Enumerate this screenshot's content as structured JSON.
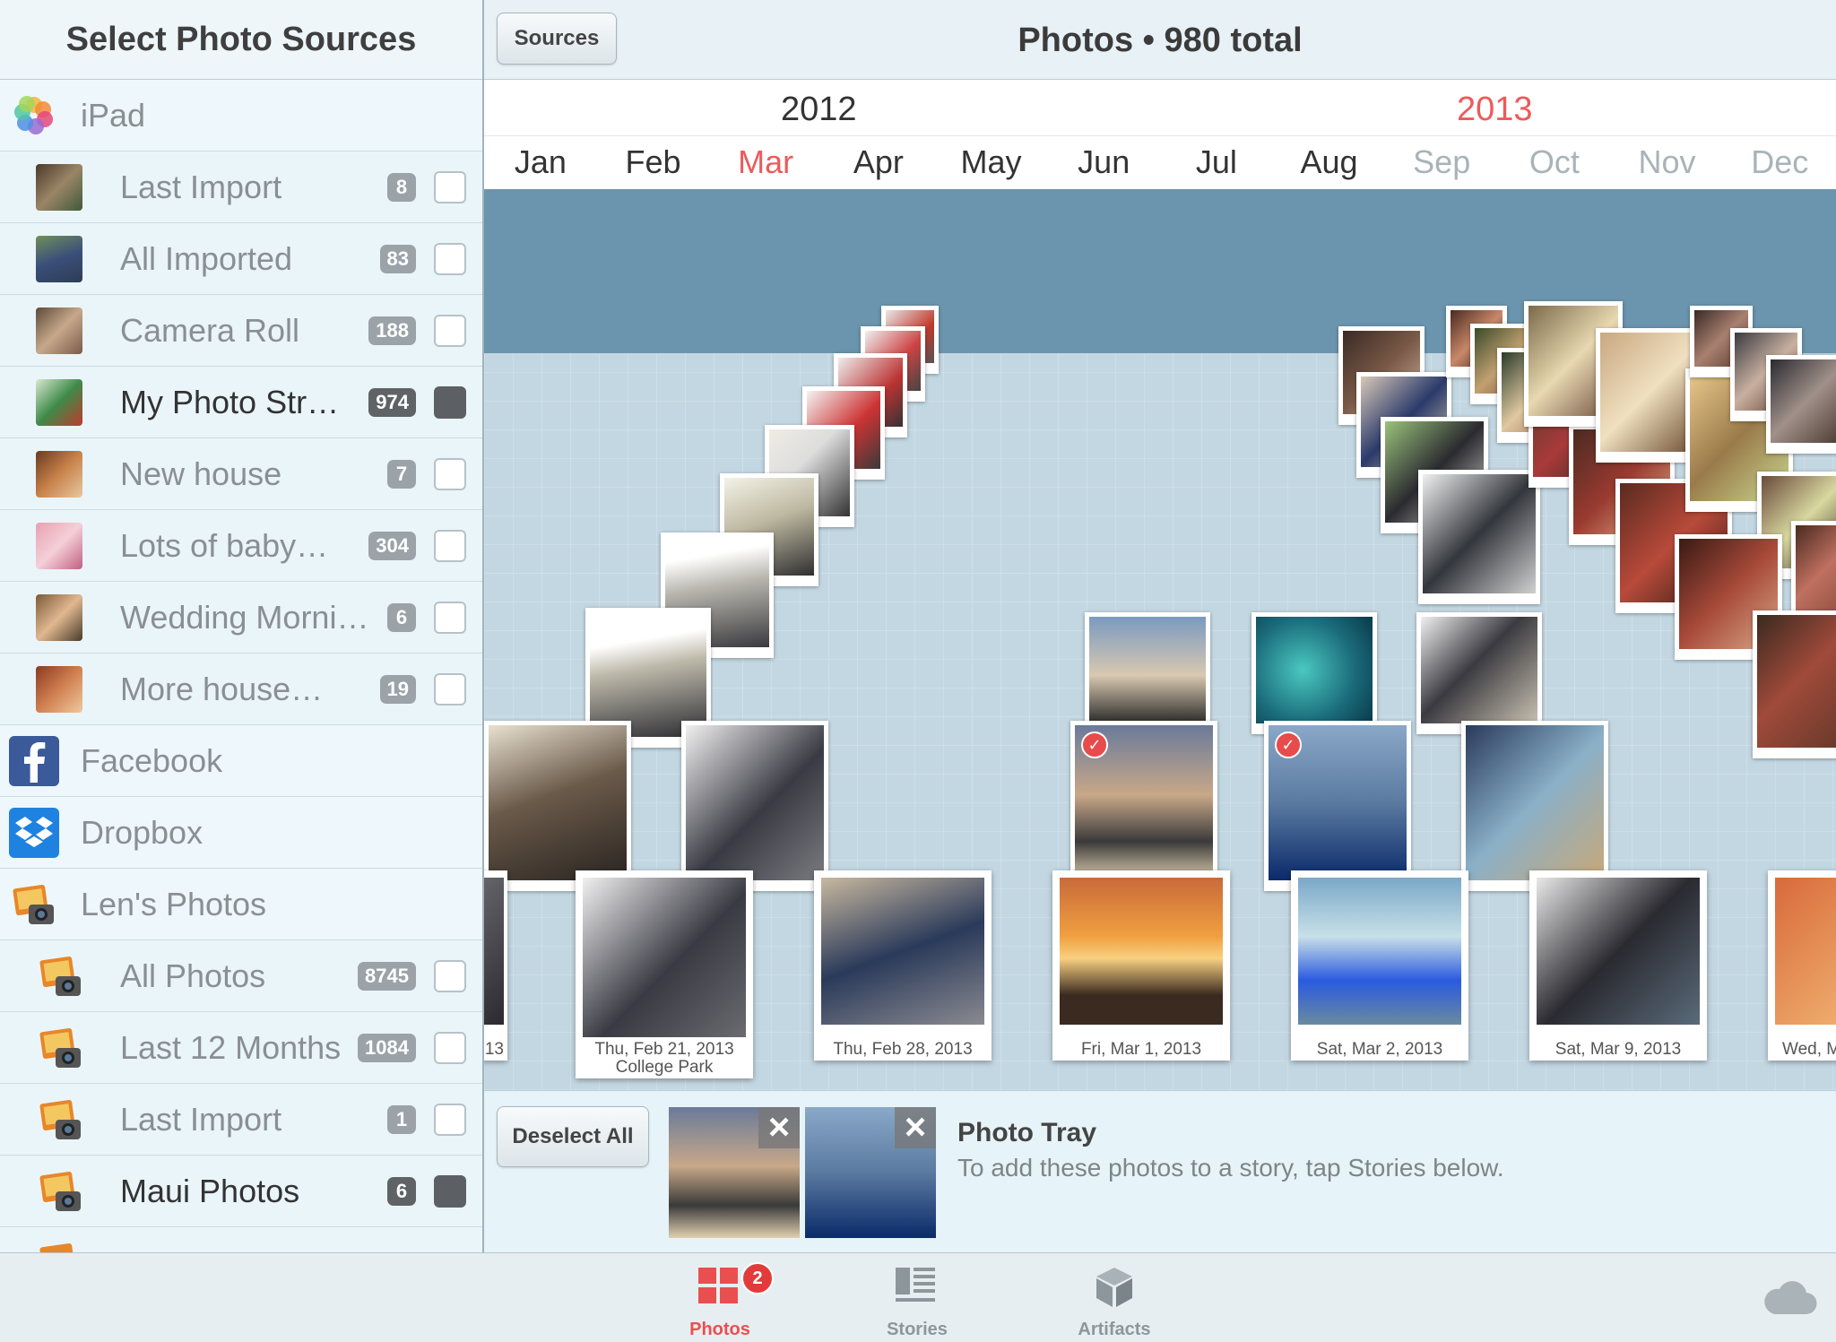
{
  "sidebar": {
    "title": "Select Photo Sources",
    "ipad": {
      "label": "iPad"
    },
    "ipad_items": [
      {
        "label": "Last Import",
        "count": "8"
      },
      {
        "label": "All Imported",
        "count": "83"
      },
      {
        "label": "Camera Roll",
        "count": "188"
      },
      {
        "label": "My Photo Str…",
        "count": "974",
        "selected": true
      },
      {
        "label": "New house",
        "count": "7"
      },
      {
        "label": "Lots of baby…",
        "count": "304"
      },
      {
        "label": "Wedding Morni…",
        "count": "6"
      },
      {
        "label": "More house…",
        "count": "19"
      }
    ],
    "facebook": {
      "label": "Facebook"
    },
    "dropbox": {
      "label": "Dropbox"
    },
    "lens": {
      "label": "Len's Photos"
    },
    "lens_items": [
      {
        "label": "All Photos",
        "count": "8745"
      },
      {
        "label": "Last 12 Months",
        "count": "1084"
      },
      {
        "label": "Last Import",
        "count": "1"
      },
      {
        "label": "Maui Photos",
        "count": "6",
        "selected": true
      }
    ]
  },
  "header": {
    "sources_button": "Sources",
    "title": "Photos • 980 total"
  },
  "timeline": {
    "year_left": "2012",
    "year_right": "2013",
    "months": [
      "Jan",
      "Feb",
      "Mar",
      "Apr",
      "May",
      "Jun",
      "Jul",
      "Aug",
      "Sep",
      "Oct",
      "Nov",
      "Dec"
    ]
  },
  "cards": {
    "c1": "Thu, Feb 21, 2013",
    "c1_sub": "College Park",
    "c2": "Thu, Feb 28, 2013",
    "c3": "Fri, Mar 1, 2013",
    "c4": "Sat, Mar 2, 2013",
    "c5": "Sat, Mar 9, 2013",
    "c6": "Wed, M",
    "c0": "13"
  },
  "tray": {
    "deselect_button": "Deselect All",
    "title": "Photo Tray",
    "text": "To add these photos to a story, tap Stories below."
  },
  "tabs": {
    "photos": "Photos",
    "photos_badge": "2",
    "stories": "Stories",
    "artifacts": "Artifacts"
  },
  "colors": {
    "accent": "#ec5b5b",
    "sky": "#6b95ae",
    "floor": "#c3d7e2"
  }
}
